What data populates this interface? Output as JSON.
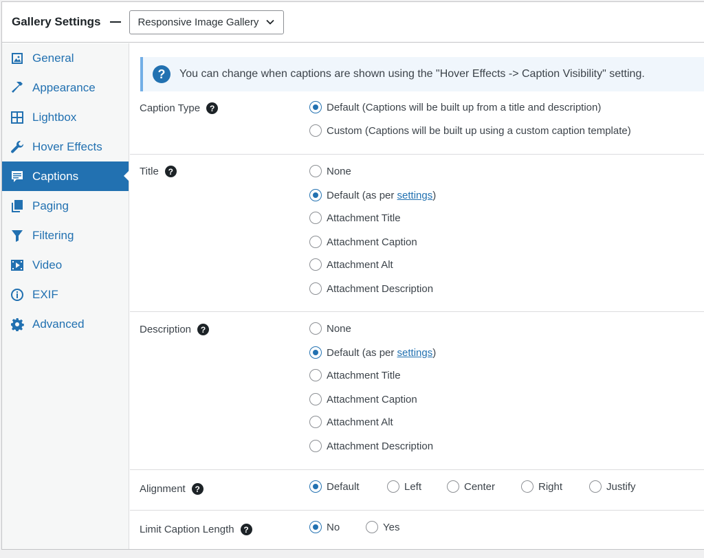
{
  "header": {
    "title": "Gallery Settings",
    "gallery_select": "Responsive Image Gallery"
  },
  "sidebar": {
    "items": [
      {
        "label": "General",
        "icon": "image-icon"
      },
      {
        "label": "Appearance",
        "icon": "hammer-icon"
      },
      {
        "label": "Lightbox",
        "icon": "grid-icon"
      },
      {
        "label": "Hover Effects",
        "icon": "wrench-icon"
      },
      {
        "label": "Captions",
        "icon": "caption-icon",
        "active": true
      },
      {
        "label": "Paging",
        "icon": "pages-icon"
      },
      {
        "label": "Filtering",
        "icon": "filter-icon"
      },
      {
        "label": "Video",
        "icon": "video-icon"
      },
      {
        "label": "EXIF",
        "icon": "info-icon"
      },
      {
        "label": "Advanced",
        "icon": "gear-icon"
      }
    ]
  },
  "notice": {
    "icon": "?",
    "text": "You can change when captions are shown using the \"Hover Effects -> Caption Visibility\" setting."
  },
  "help_glyph": "?",
  "settings": {
    "caption_type": {
      "label": "Caption Type",
      "options": [
        {
          "label": "Default (Captions will be built up from a title and description)",
          "checked": true
        },
        {
          "label": "Custom (Captions will be built up using a custom caption template)",
          "checked": false
        }
      ]
    },
    "title": {
      "label": "Title",
      "options": {
        "none": "None",
        "default_prefix": "Default (as per ",
        "default_link": "settings",
        "default_suffix": ")",
        "attachment_title": "Attachment Title",
        "attachment_caption": "Attachment Caption",
        "attachment_alt": "Attachment Alt",
        "attachment_description": "Attachment Description"
      },
      "selected": "default"
    },
    "description": {
      "label": "Description",
      "options": {
        "none": "None",
        "default_prefix": "Default (as per ",
        "default_link": "settings",
        "default_suffix": ")",
        "attachment_title": "Attachment Title",
        "attachment_caption": "Attachment Caption",
        "attachment_alt": "Attachment Alt",
        "attachment_description": "Attachment Description"
      },
      "selected": "default"
    },
    "alignment": {
      "label": "Alignment",
      "options": [
        "Default",
        "Left",
        "Center",
        "Right",
        "Justify"
      ],
      "selected": "Default"
    },
    "limit_caption_length": {
      "label": "Limit Caption Length",
      "options": [
        "No",
        "Yes"
      ],
      "selected": "No"
    }
  },
  "colors": {
    "accent": "#2271b1",
    "notice_bg": "#f0f6fc",
    "notice_border": "#72aee6"
  }
}
